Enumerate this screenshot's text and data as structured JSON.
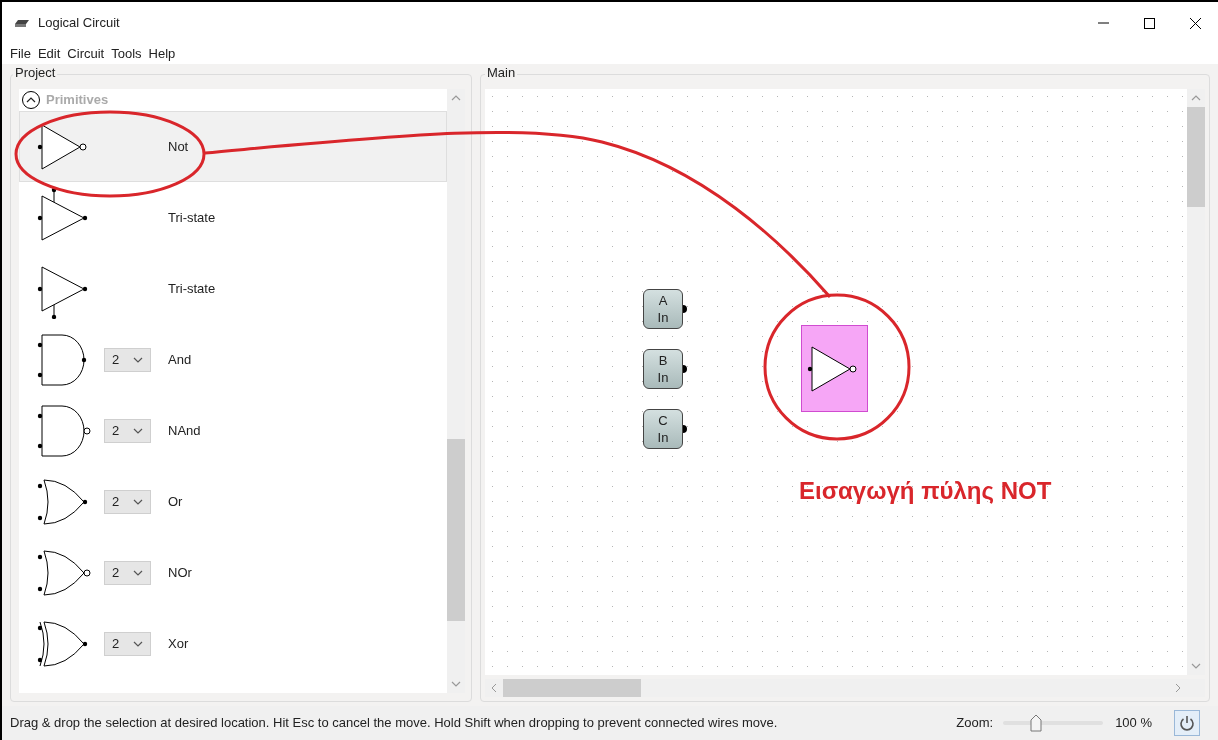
{
  "window": {
    "title": "Logical Circuit"
  },
  "menu": [
    "File",
    "Edit",
    "Circuit",
    "Tools",
    "Help"
  ],
  "project": {
    "title": "Project",
    "category": {
      "label": "Primitives",
      "expanded": true
    },
    "items": [
      {
        "kind": "not",
        "label": "Not",
        "selected": true
      },
      {
        "kind": "tristate_top",
        "label": "Tri-state",
        "selected": false
      },
      {
        "kind": "tristate_bottom",
        "label": "Tri-state",
        "selected": false
      },
      {
        "kind": "and",
        "inputs": "2",
        "label": "And",
        "selected": false
      },
      {
        "kind": "nand",
        "inputs": "2",
        "label": "NAnd",
        "selected": false
      },
      {
        "kind": "or",
        "inputs": "2",
        "label": "Or",
        "selected": false
      },
      {
        "kind": "nor",
        "inputs": "2",
        "label": "NOr",
        "selected": false
      },
      {
        "kind": "xor",
        "inputs": "2",
        "label": "Xor",
        "selected": false
      }
    ]
  },
  "main": {
    "title": "Main",
    "inputs": [
      {
        "letter": "A",
        "label": "In"
      },
      {
        "letter": "B",
        "label": "In"
      },
      {
        "letter": "C",
        "label": "In"
      }
    ],
    "gate": {
      "kind": "not",
      "selected": true
    },
    "annotation": "Εισαγωγή πύλης NOT"
  },
  "status_bar": {
    "message": "Drag & drop the selection at desired location. Hit Esc to cancel the move. Hold Shift when dropping to prevent connected wires move.",
    "zoom_label": "Zoom:",
    "zoom": {
      "level": 0.33
    },
    "zoom_value": "100 %"
  }
}
